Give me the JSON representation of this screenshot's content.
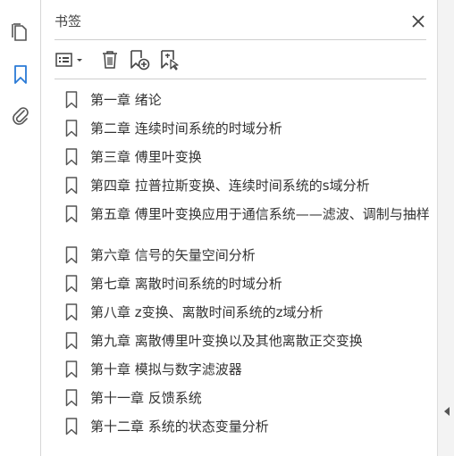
{
  "panel": {
    "title": "书签"
  },
  "toolbar": {
    "icons": [
      "options-list-icon",
      "delete-icon",
      "new-bookmark-icon",
      "new-bookmark-from-structure-icon"
    ]
  },
  "bookmarks": [
    {
      "label": "第一章  绪论"
    },
    {
      "label": "第二章  连续时间系统的时域分析"
    },
    {
      "label": "第三章  傅里叶变换"
    },
    {
      "label": "第四章  拉普拉斯变换、连续时间系统的s域分析"
    },
    {
      "label": "第五章  傅里叶变换应用于通信系统——滤波、调制与抽样"
    },
    {
      "label": "第六章  信号的矢量空间分析"
    },
    {
      "label": "第七章  离散时间系统的时域分析"
    },
    {
      "label": "第八章  z变换、离散时间系统的z域分析"
    },
    {
      "label": "第九章  离散傅里叶变换以及其他离散正交变换"
    },
    {
      "label": "第十章  模拟与数字滤波器"
    },
    {
      "label": "第十一章  反馈系统"
    },
    {
      "label": "第十二章  系统的状态变量分析"
    }
  ],
  "colors": {
    "accent": "#2a7ad6",
    "icon": "#4a4a4a",
    "text": "#333333"
  }
}
